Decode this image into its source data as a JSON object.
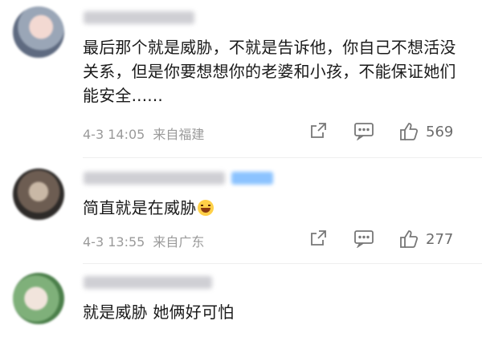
{
  "comments": [
    {
      "text": "最后那个就是威胁，不就是告诉他，你自己不想活没关系，但是你要想想你的老婆和小孩，不能保证她们能安全......",
      "date": "4-3 14:05",
      "location": "来自福建",
      "likes": "569"
    },
    {
      "text": "简直就是在威胁",
      "emoji": "laughing-tears",
      "date": "4-3 13:55",
      "location": "来自广东",
      "likes": "277"
    },
    {
      "text": "就是威胁 她俩好可怕"
    }
  ],
  "icons": {
    "share": "share-icon",
    "comment": "comment-icon",
    "like": "thumbs-up-icon"
  }
}
